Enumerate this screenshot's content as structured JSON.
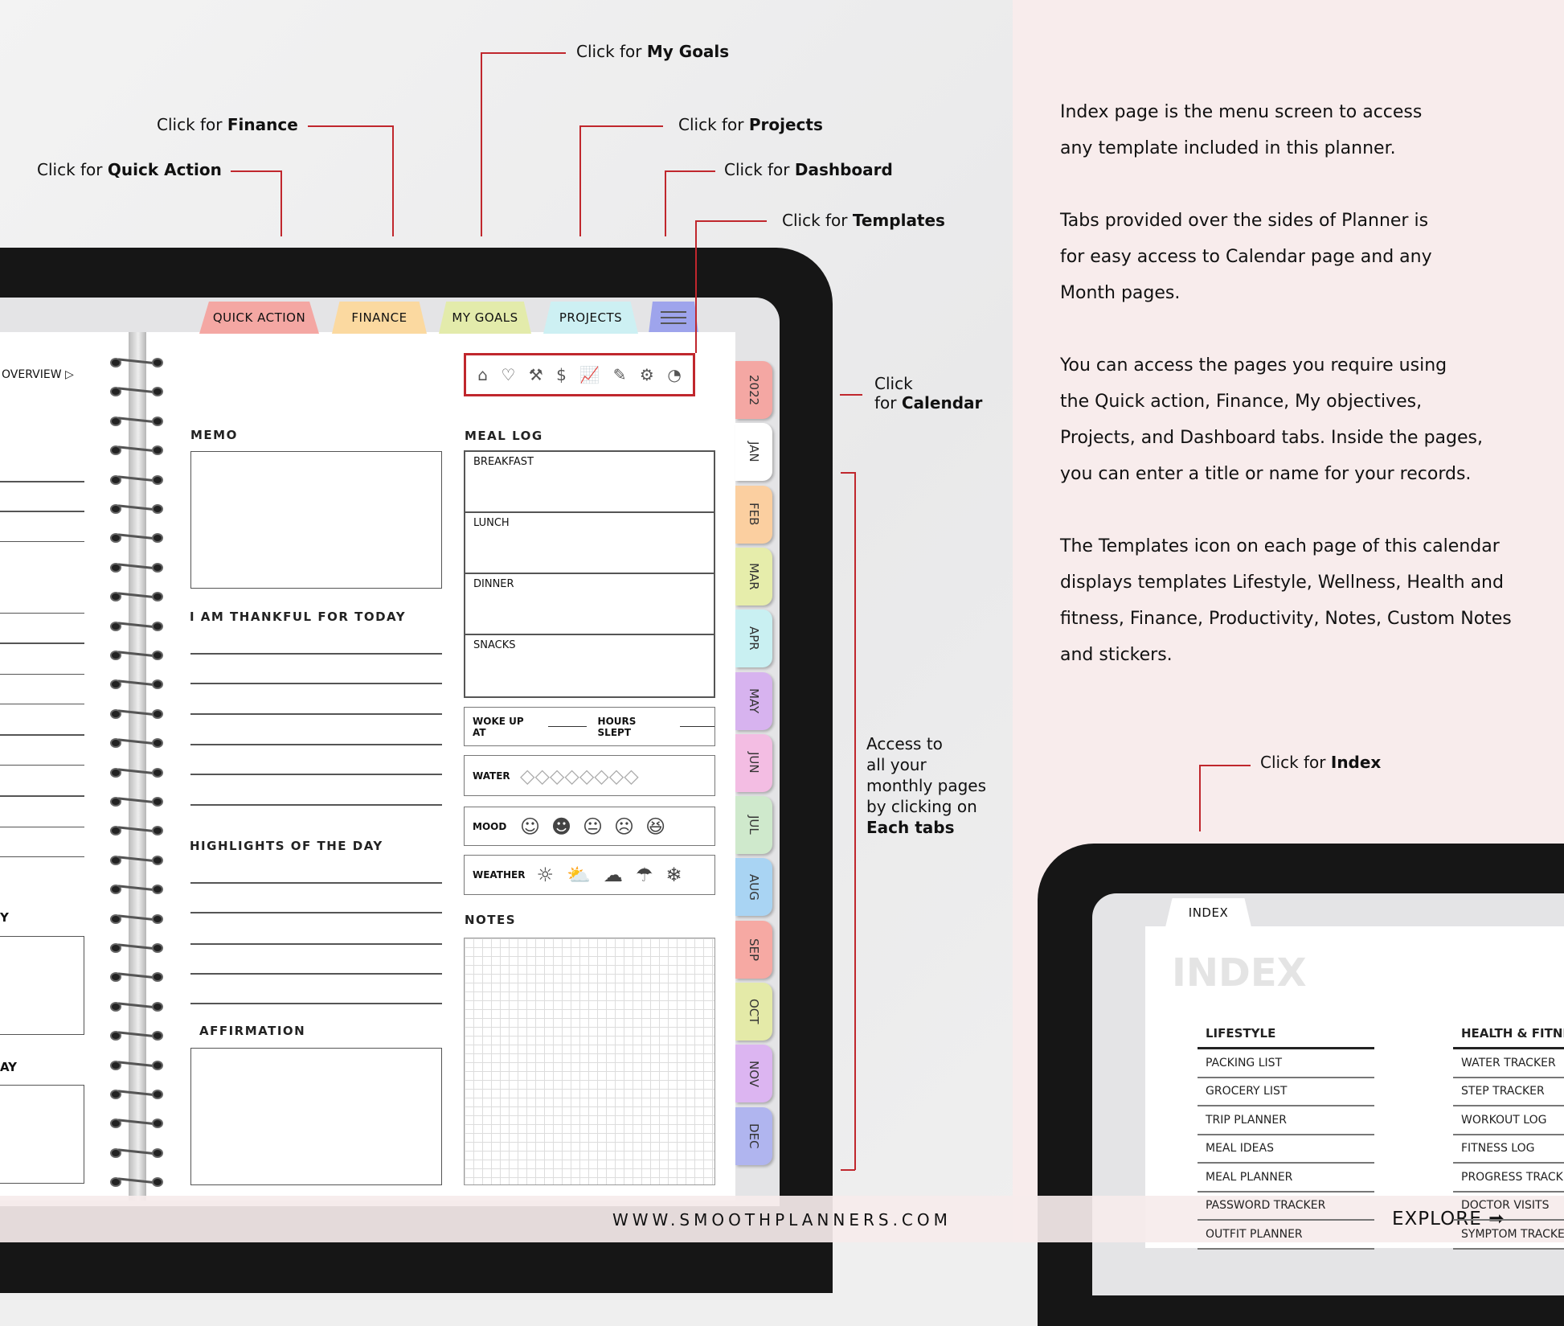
{
  "annotations": {
    "prefix": "Click for",
    "my_goals": "My Goals",
    "finance": "Finance",
    "quick_action": "Quick Action",
    "projects": "Projects",
    "dashboard": "Dashboard",
    "templates": "Templates",
    "calendar_1": "Click",
    "calendar_2": "for",
    "calendar_3": "Calendar",
    "access_lines": [
      "Access to",
      "all your",
      "monthly pages",
      "by clicking on"
    ],
    "access_bold": "Each tabs",
    "index": "Index"
  },
  "description": [
    "Index page is the menu screen to access",
    "any template included in this planner.",
    "",
    "Tabs provided over the sides of Planner is",
    "for easy access to Calendar page and  any",
    "Month pages.",
    "",
    "You can access the pages you require using",
    "the Quick action, Finance, My objectives,",
    "Projects, and Dashboard tabs. Inside the pages,",
    "you can enter a title or name for your records.",
    "",
    "The Templates icon on each page of this calendar",
    "displays templates Lifestyle, Wellness, Health and",
    "fitness, Finance, Productivity, Notes, Custom Notes",
    "and stickers."
  ],
  "top_tabs": [
    {
      "label": "QUICK ACTION",
      "color": "#f4a7a3"
    },
    {
      "label": "FINANCE",
      "color": "#fbd9a0"
    },
    {
      "label": "MY GOALS",
      "color": "#e3ebab"
    },
    {
      "label": "PROJECTS",
      "color": "#cdf0f3"
    }
  ],
  "menu_tab_color": "#9ea4ec",
  "month_tabs": [
    {
      "label": "2022",
      "color": "#f4a7a3"
    },
    {
      "label": "JAN",
      "color": "#ffffff"
    },
    {
      "label": "FEB",
      "color": "#fbcfa0"
    },
    {
      "label": "MAR",
      "color": "#e6edab"
    },
    {
      "label": "APR",
      "color": "#c9f0f2"
    },
    {
      "label": "MAY",
      "color": "#d7b3ef"
    },
    {
      "label": "JUN",
      "color": "#f3bde3"
    },
    {
      "label": "JUL",
      "color": "#cfe9cc"
    },
    {
      "label": "AUG",
      "color": "#a9d4f3"
    },
    {
      "label": "SEP",
      "color": "#f6a9a3"
    },
    {
      "label": "OCT",
      "color": "#e4eaa8"
    },
    {
      "label": "NOV",
      "color": "#dcb5f1"
    },
    {
      "label": "DEC",
      "color": "#b0b5ef"
    }
  ],
  "template_icons": [
    "home-icon",
    "heart-pulse-icon",
    "dumbbell-icon",
    "money-bag-icon",
    "growth-chart-icon",
    "notes-icon",
    "settings-icon",
    "sticker-icon"
  ],
  "left_page": {
    "overview": "OVERVIEW",
    "label1": "Y",
    "label2": "AY"
  },
  "page": {
    "memo": "MEMO",
    "thankful": "I AM THANKFUL  FOR TODAY",
    "highlights": "HIGHLIGHTS  OF  THE  DAY",
    "affirmation": "AFFIRMATION",
    "meal_log": "MEAL  LOG",
    "meals": [
      "BREAKFAST",
      "LUNCH",
      "DINNER",
      "SNACKS"
    ],
    "woke_up": "WOKE UP AT",
    "hours_slept": "HOURS  SLEPT",
    "water": "WATER",
    "mood": "MOOD",
    "weather": "WEATHER",
    "notes": "NOTES"
  },
  "index_page": {
    "tab": "INDEX",
    "title": "INDEX",
    "lifestyle_header": "LIFESTYLE",
    "lifestyle": [
      "PACKING  LIST",
      "GROCERY LIST",
      "TRIP PLANNER",
      "MEAL  IDEAS",
      "MEAL  PLANNER",
      "PASSWORD TRACKER",
      "OUTFIT PLANNER"
    ],
    "health_header": "HEALTH  & FITNESS",
    "health": [
      "WATER TRACKER",
      "STEP TRACKER",
      "WORKOUT LOG",
      "FITNESS LOG",
      "PROGRESS TRACKER",
      "DOCTOR VISITS",
      "SYMPTOM  TRACKER"
    ]
  },
  "footer": {
    "website": "WWW.SMOOTHPLANNERS.COM",
    "explore": "EXPLORE"
  },
  "accent": "#c0272d"
}
